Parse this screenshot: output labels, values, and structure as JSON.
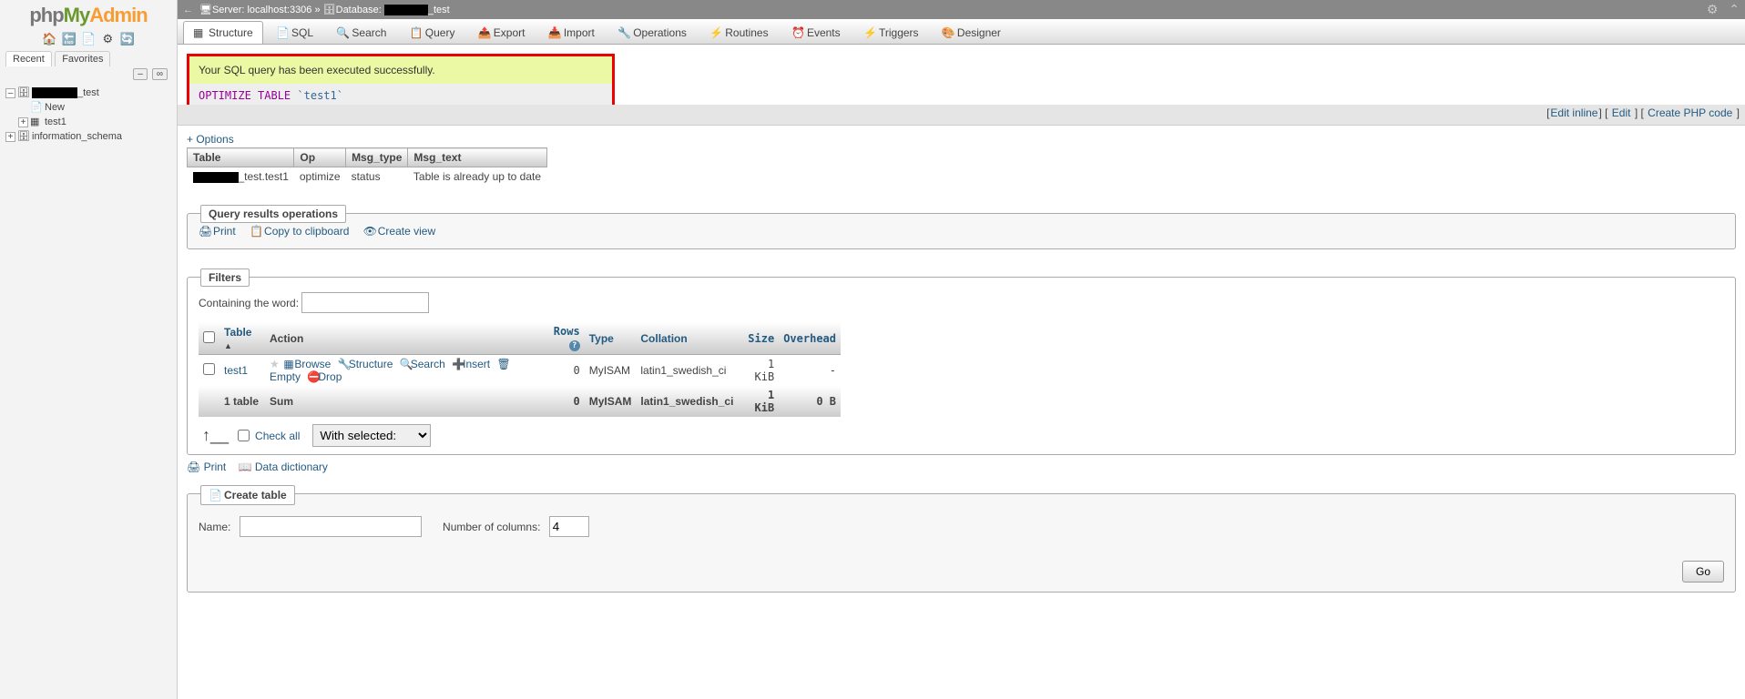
{
  "sidebar": {
    "tabs": {
      "recent": "Recent",
      "favorites": "Favorites"
    },
    "tree": {
      "db_suffix": "_test",
      "new": "New",
      "test1": "test1",
      "info_schema": "information_schema"
    }
  },
  "topbar": {
    "server_label": "Server: localhost:3306",
    "db_label": "Database:",
    "db_suffix": "_test"
  },
  "tabs": {
    "structure": "Structure",
    "sql": "SQL",
    "search": "Search",
    "query": "Query",
    "export": "Export",
    "import": "Import",
    "operations": "Operations",
    "routines": "Routines",
    "events": "Events",
    "triggers": "Triggers",
    "designer": "Designer"
  },
  "success": {
    "msg": "Your SQL query has been executed successfully.",
    "sql_kw1": "OPTIMIZE",
    "sql_kw2": "TABLE",
    "sql_tbl": "`test1`"
  },
  "links": {
    "edit_inline": "Edit inline",
    "edit": "Edit",
    "create_php": "Create PHP code",
    "options": "+ Options"
  },
  "result": {
    "h_table": "Table",
    "h_op": "Op",
    "h_msgtype": "Msg_type",
    "h_msgtext": "Msg_text",
    "r_table_suffix": "_test.test1",
    "r_op": "optimize",
    "r_msgtype": "status",
    "r_msgtext": "Table is already up to date"
  },
  "qro": {
    "title": "Query results operations",
    "print": "Print",
    "copy": "Copy to clipboard",
    "create_view": "Create view"
  },
  "filters": {
    "title": "Filters",
    "label": "Containing the word:"
  },
  "list": {
    "h_table": "Table",
    "h_action": "Action",
    "h_rows": "Rows",
    "h_type": "Type",
    "h_collation": "Collation",
    "h_size": "Size",
    "h_overhead": "Overhead",
    "row": {
      "name": "test1",
      "browse": "Browse",
      "structure": "Structure",
      "search": "Search",
      "insert": "Insert",
      "empty": "Empty",
      "drop": "Drop",
      "rows": "0",
      "type": "MyISAM",
      "collation": "latin1_swedish_ci",
      "size": "1 KiB",
      "overhead": "-"
    },
    "sum": {
      "label": "1 table",
      "sum": "Sum",
      "rows": "0",
      "type": "MyISAM",
      "collation": "latin1_swedish_ci",
      "size": "1 KiB",
      "overhead": "0 B"
    }
  },
  "checkall": {
    "label": "Check all",
    "with_selected": "With selected:"
  },
  "bottom": {
    "print": "Print",
    "data_dict": "Data dictionary"
  },
  "create": {
    "title": "Create table",
    "name_label": "Name:",
    "cols_label": "Number of columns:",
    "cols_value": "4",
    "go": "Go"
  }
}
